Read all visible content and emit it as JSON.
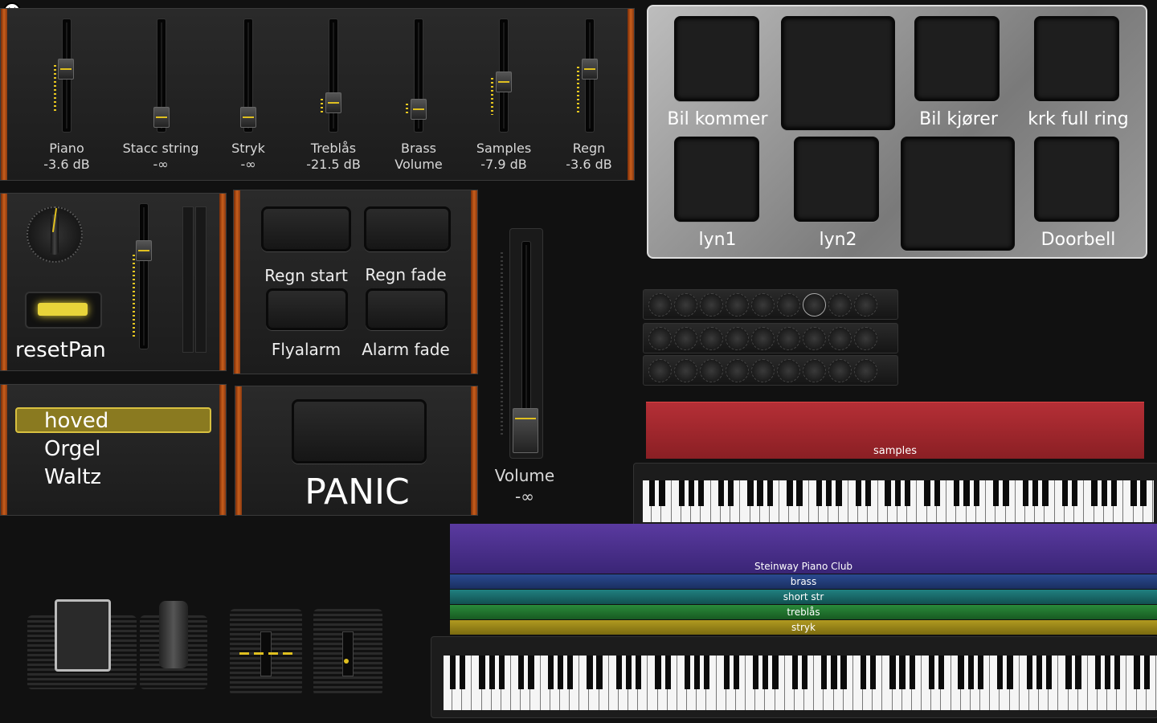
{
  "mixer": {
    "channels": [
      {
        "name": "Piano",
        "value": "-3.6 dB"
      },
      {
        "name": "Stacc string",
        "value": "-∞"
      },
      {
        "name": "Stryk",
        "value": "-∞"
      },
      {
        "name": "Treblås",
        "value": "-21.5 dB"
      },
      {
        "name": "Brass",
        "value": "Volume"
      },
      {
        "name": "Samples",
        "value": "-7.9 dB"
      },
      {
        "name": "Regn",
        "value": "-3.6 dB"
      }
    ]
  },
  "pads": {
    "labels": [
      "Bil kommer",
      "Bil kjører",
      "krk full ring",
      "lyn1",
      "lyn2",
      "Doorbell"
    ]
  },
  "reset": {
    "label": "resetPan"
  },
  "buttons": {
    "regn_start": "Regn start",
    "regn_fade": "Regn fade",
    "flyalarm": "Flyalarm",
    "alarm_fade": "Alarm fade"
  },
  "patches": {
    "items": [
      "hoved",
      "Orgel",
      "Waltz"
    ]
  },
  "panic": {
    "label": "PANIC"
  },
  "volume": {
    "name": "Volume",
    "value": "-∞"
  },
  "tracks": {
    "samples": "samples",
    "steinway": "Steinway Piano Club",
    "brass": "brass",
    "short": "short str",
    "treblas": "treblås",
    "stryk": "stryk"
  },
  "colors": {
    "accent": "#e0c020",
    "wood": "#c85e1c",
    "samples_track": "#b02a30",
    "piano_track": "#5a3aa0"
  }
}
